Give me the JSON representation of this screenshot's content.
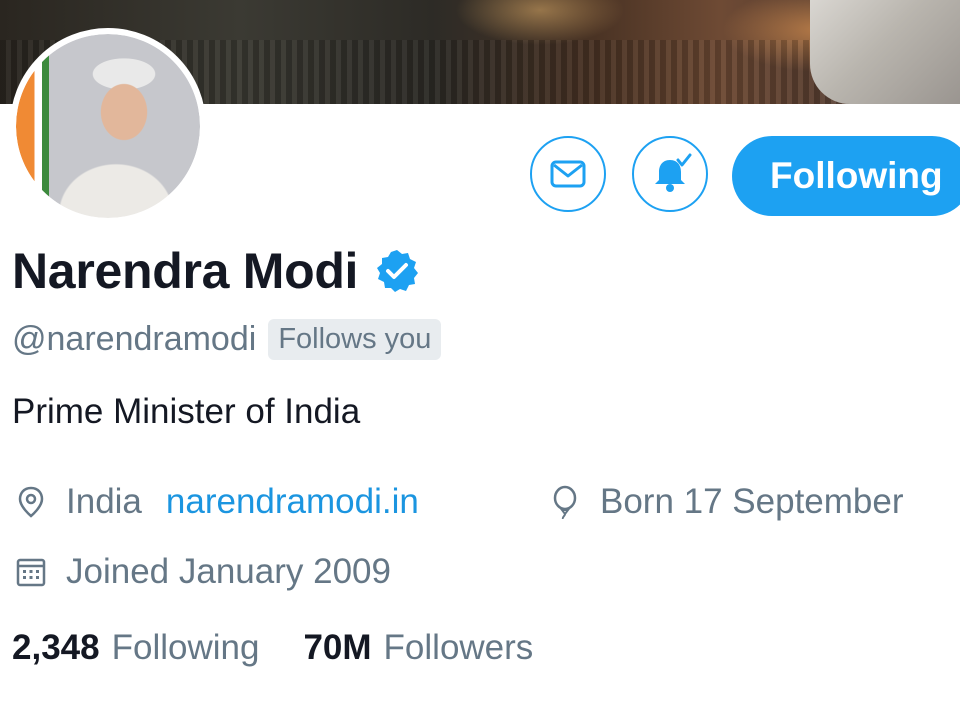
{
  "profile": {
    "name": "Narendra Modi",
    "handle": "@narendramodi",
    "follows_you": "Follows you",
    "bio": "Prime Minister of India",
    "location": "India",
    "website": "narendramodi.in",
    "birthday": "Born 17 September",
    "joined": "Joined January 2009",
    "verified": true
  },
  "actions": {
    "following_label": "Following",
    "message_icon": "envelope-icon",
    "notify_icon": "bell-icon"
  },
  "stats": {
    "following_count": "2,348",
    "following_label": "Following",
    "followers_count": "70M",
    "followers_label": "Followers"
  },
  "colors": {
    "accent": "#1da1f2",
    "link": "#1b95e0",
    "muted_text": "#657786",
    "primary_text": "#141823"
  }
}
